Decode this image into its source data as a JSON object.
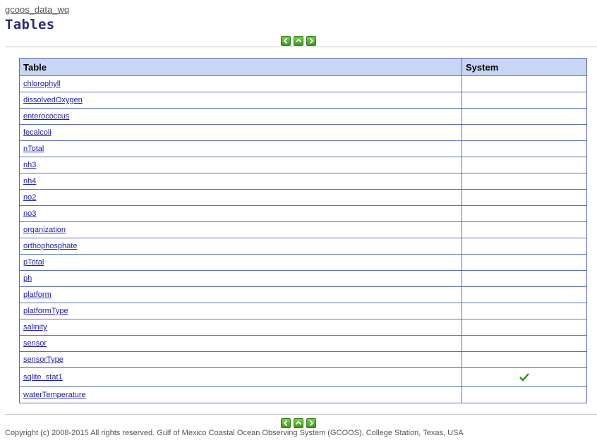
{
  "header": {
    "db_name": "gcoos_data_wq",
    "title": "Tables"
  },
  "nav": {
    "prev_icon": "arrow-left-icon",
    "up_icon": "arrow-up-icon",
    "next_icon": "arrow-right-icon"
  },
  "table": {
    "columns": [
      "Table",
      "System"
    ],
    "rows": [
      {
        "name": "chlorophyll",
        "system": false
      },
      {
        "name": "dissolvedOxygen",
        "system": false
      },
      {
        "name": "enterococcus",
        "system": false
      },
      {
        "name": "fecalcoli",
        "system": false
      },
      {
        "name": "nTotal",
        "system": false
      },
      {
        "name": "nh3",
        "system": false
      },
      {
        "name": "nh4",
        "system": false
      },
      {
        "name": "no2",
        "system": false
      },
      {
        "name": "no3",
        "system": false
      },
      {
        "name": "organization",
        "system": false
      },
      {
        "name": "orthophosphate",
        "system": false
      },
      {
        "name": "pTotal",
        "system": false
      },
      {
        "name": "ph",
        "system": false
      },
      {
        "name": "platform",
        "system": false
      },
      {
        "name": "platformType",
        "system": false
      },
      {
        "name": "salinity",
        "system": false
      },
      {
        "name": "sensor",
        "system": false
      },
      {
        "name": "sensorType",
        "system": false
      },
      {
        "name": "sqlite_stat1",
        "system": true
      },
      {
        "name": "waterTemperature",
        "system": false
      }
    ]
  },
  "footer": {
    "copyright": "Copyright (c) 2008-2015 All rights reserved. Gulf of Mexico Coastal Ocean Observing System (GCOOS), College Station, Texas, USA"
  },
  "colors": {
    "header_bg": "#c8d6f4",
    "border": "#5a6fb8",
    "link": "#2020b0",
    "title": "#2a2a7a",
    "nav_green": "#3f9a1f",
    "check_green": "#2a8a18"
  }
}
